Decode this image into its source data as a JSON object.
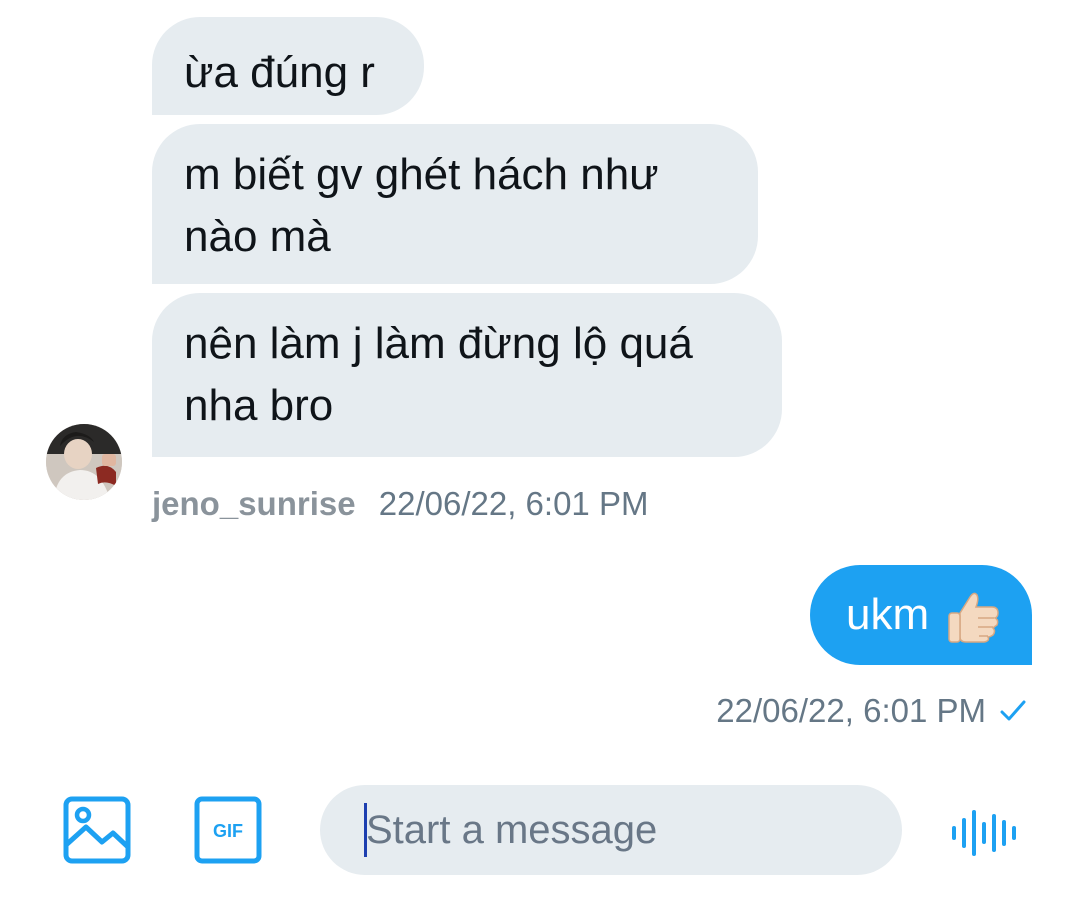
{
  "conversation": {
    "incoming": {
      "messages": [
        "ừa đúng r",
        "m biết gv ghét hách như nào mà",
        "nên làm j làm đừng lộ quá nha bro"
      ],
      "username": "jeno_sunrise",
      "timestamp": "22/06/22, 6:01 PM"
    },
    "outgoing": {
      "message": "ukm",
      "emoji_icon": "thumbs-up-icon",
      "timestamp": "22/06/22, 6:01 PM",
      "status_icon": "checkmark-icon"
    }
  },
  "composer": {
    "placeholder": "Start a message",
    "value": "",
    "media_icon": "image-icon",
    "gif_label": "GIF",
    "voice_icon": "voice-waveform-icon"
  },
  "colors": {
    "accent": "#1da1f2",
    "incoming_bubble": "#e6ecf0",
    "secondary_text": "#657786"
  }
}
